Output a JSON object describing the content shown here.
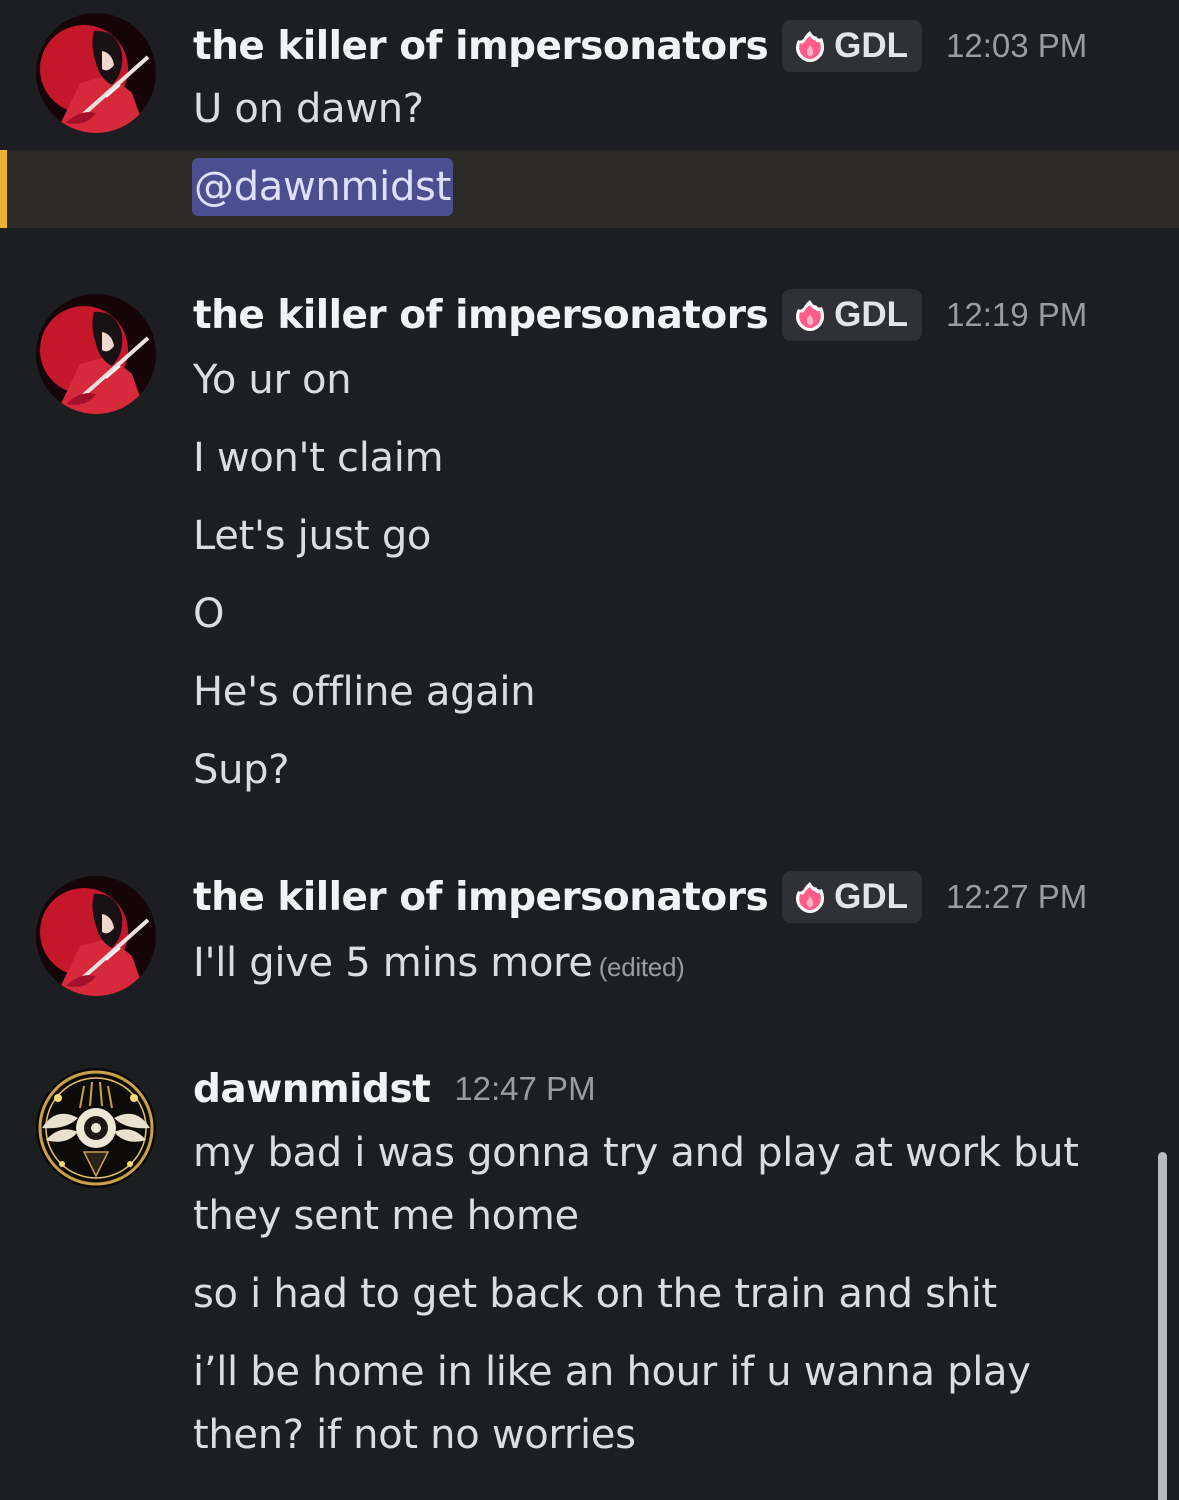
{
  "messages": [
    {
      "username": "the killer of impersonators",
      "tag": "GDL",
      "time": "12:03 PM",
      "lines": [
        "U on dawn?"
      ],
      "mention": "@dawnmidst"
    },
    {
      "username": "the killer of impersonators",
      "tag": "GDL",
      "time": "12:19 PM",
      "lines": [
        "Yo ur on",
        "I won't claim",
        "Let's just go",
        "O",
        "He's offline again",
        "Sup?"
      ]
    },
    {
      "username": "the killer of impersonators",
      "tag": "GDL",
      "time": "12:27 PM",
      "lines": [
        "I'll give 5 mins more"
      ],
      "edited": "(edited)"
    },
    {
      "username": "dawnmidst",
      "time": "12:47 PM",
      "lines": [
        "my bad i was gonna try and play at work but",
        "they sent me home",
        "so i had to get back on the train and shit",
        "i’ll be home in like an hour if u wanna play",
        "then? if not no worries"
      ]
    }
  ],
  "colors": {
    "background": "#1d1e22",
    "mention_highlight": "#2b2a27",
    "mention_bar": "#f0b232",
    "mention_pill": "#4c4f8f",
    "username": "#f2f3f5",
    "timestamp": "#9a9ca3"
  },
  "icons": {
    "tag_icon": "pink-flame-icon",
    "avatar_1": "red-samurai-avatar",
    "avatar_2": "eye-emblem-avatar"
  }
}
